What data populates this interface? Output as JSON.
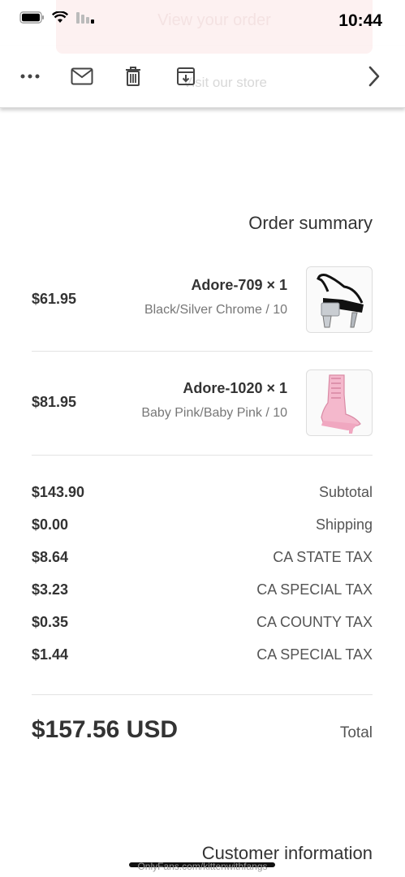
{
  "status_bar": {
    "time": "10:44"
  },
  "background_banner": {
    "text": "View your order",
    "link_text": "Visit our store"
  },
  "order_summary": {
    "title": "Order summary",
    "items": [
      {
        "name": "Adore-709 × 1",
        "variant": "Black/Silver Chrome / 10",
        "price": "$61.95"
      },
      {
        "name": "Adore-1020 × 1",
        "variant": "Baby Pink/Baby Pink / 10",
        "price": "$81.95"
      }
    ],
    "lines": [
      {
        "label": "Subtotal",
        "value": "$143.90"
      },
      {
        "label": "Shipping",
        "value": "$0.00"
      },
      {
        "label": "CA STATE TAX",
        "value": "$8.64"
      },
      {
        "label": "CA SPECIAL TAX",
        "value": "$3.23"
      },
      {
        "label": "CA COUNTY TAX",
        "value": "$0.35"
      },
      {
        "label": "CA SPECIAL TAX",
        "value": "$1.44"
      }
    ],
    "total_label": "Total",
    "total_value": "$157.56 USD"
  },
  "customer_information": {
    "title": "Customer information"
  },
  "watermark": "OnlyFans.com/kittenwithfangs",
  "colors": {
    "text": "#333333",
    "muted": "#777777",
    "divider": "#e3e3e3",
    "banner": "#fdf1f1"
  }
}
